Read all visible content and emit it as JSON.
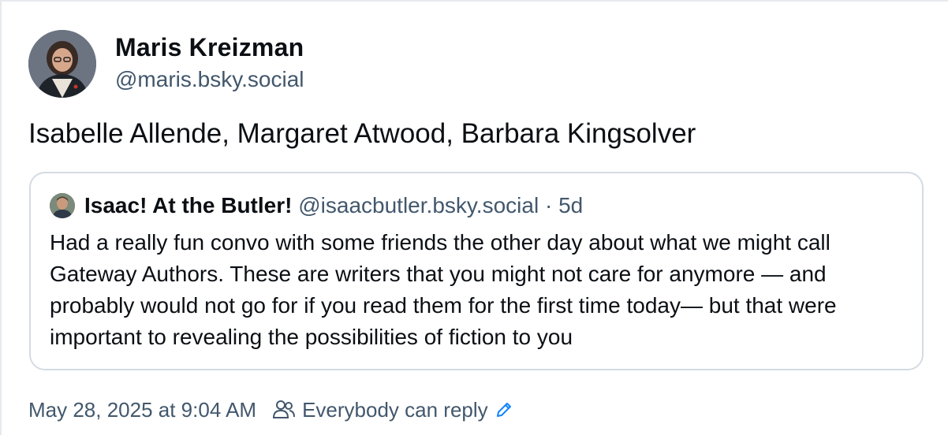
{
  "author": {
    "display_name": "Maris Kreizman",
    "handle": "@maris.bsky.social"
  },
  "post": {
    "text": "Isabelle Allende, Margaret Atwood, Barbara Kingsolver"
  },
  "quote": {
    "display_name": "Isaac! At the Butler!",
    "handle": "@isaacbutler.bsky.social",
    "separator": "·",
    "time": "5d",
    "text": "Had a really fun convo with some friends the other day about what we might call Gateway Authors. These are writers that you might not care for anymore — and probably would not go for if you read them for the first time today— but that were important to revealing the possibilities of fiction to you"
  },
  "meta": {
    "timestamp": "May 28, 2025 at 9:04 AM",
    "reply_setting": "Everybody can reply",
    "people_icon": "people-icon",
    "edit_icon": "pencil-icon"
  },
  "colors": {
    "text": "#0b0f14",
    "secondary": "#42576c",
    "border": "#d4dbe2",
    "accent": "#1083fe"
  }
}
